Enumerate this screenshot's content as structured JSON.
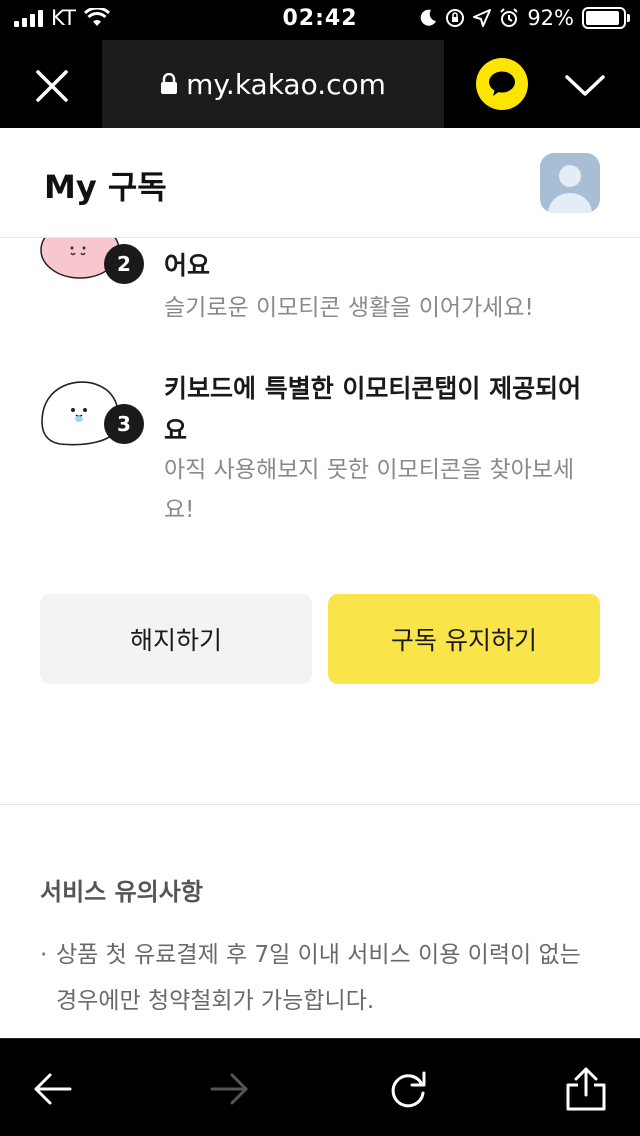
{
  "status_bar": {
    "carrier": "KT",
    "time": "02:42",
    "battery_percent": "92%",
    "battery_level": 0.92,
    "icons": [
      "signal-icon",
      "wifi-icon",
      "moon-icon",
      "orientation-lock-icon",
      "location-icon",
      "alarm-icon",
      "battery-icon"
    ]
  },
  "browser": {
    "url": "my.kakao.com",
    "icons": [
      "close-icon",
      "lock-icon",
      "kakaotalk-icon",
      "chevron-down-icon"
    ]
  },
  "header": {
    "title": "My 구독",
    "avatar": "profile-avatar-icon"
  },
  "benefits": [
    {
      "number": "2",
      "title_line": "어요",
      "desc": "슬기로운 이모티콘 생활을 이어가세요!",
      "emoticon_color": "#f7c6cf"
    },
    {
      "number": "3",
      "title": "키보드에 특별한 이모티콘탭이 제공되어요",
      "desc": "아직 사용해보지 못한 이모티콘을 찾아보세요!",
      "emoticon_color": "#ffffff"
    }
  ],
  "buttons": {
    "cancel": "해지하기",
    "keep": "구독 유지하기"
  },
  "notice": {
    "title": "서비스 유의사항",
    "bullet": "·",
    "items": [
      "상품 첫 유료결제 후 7일 이내 서비스 이용 이력이 없는 경우에만 청약철회가 가능합니다."
    ]
  },
  "toolbar": {
    "icons": [
      "back-arrow-icon",
      "forward-arrow-icon",
      "reload-icon",
      "share-icon"
    ]
  },
  "colors": {
    "accent_yellow": "#f9e54a",
    "kakao_yellow": "#fee500",
    "cancel_gray": "#f3f3f3"
  }
}
